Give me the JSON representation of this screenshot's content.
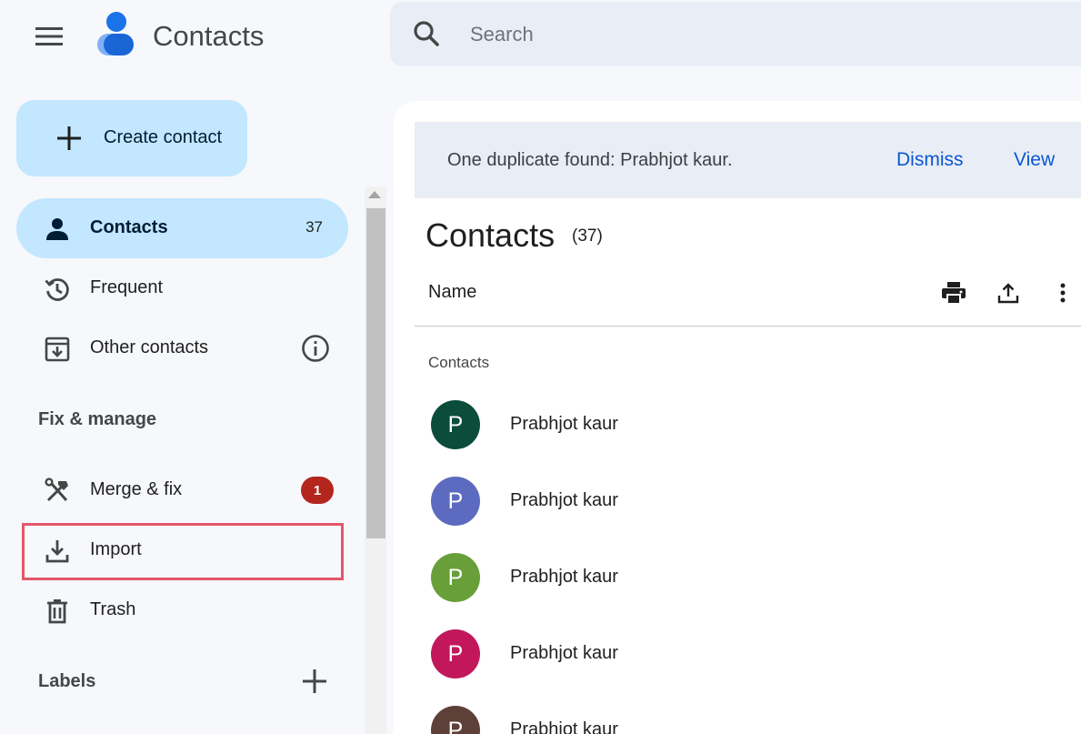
{
  "header": {
    "app_title": "Contacts",
    "search_placeholder": "Search",
    "menu_icon": "hamburger-menu-icon",
    "logo": "contacts-logo"
  },
  "sidebar": {
    "create_label": "Create contact",
    "nav": [
      {
        "label": "Contacts",
        "count": "37",
        "icon": "person-icon",
        "active": true
      },
      {
        "label": "Frequent",
        "icon": "history-icon"
      },
      {
        "label": "Other contacts",
        "icon": "archive-download-icon",
        "extra_icon": "info-icon"
      }
    ],
    "fix_heading": "Fix & manage",
    "fix_items": [
      {
        "label": "Merge & fix",
        "icon": "merge-tools-icon",
        "badge": "1"
      },
      {
        "label": "Import",
        "icon": "download-icon",
        "highlighted": true
      },
      {
        "label": "Trash",
        "icon": "trash-icon"
      }
    ],
    "labels_heading": "Labels"
  },
  "banner": {
    "message": "One duplicate found: Prabhjot kaur.",
    "dismiss_label": "Dismiss",
    "view_label": "View"
  },
  "main": {
    "title": "Contacts",
    "count": "(37)",
    "column_name": "Name",
    "group_label": "Contacts",
    "contacts": [
      {
        "name": "Prabhjot kaur",
        "initial": "P",
        "color": "#0b4c3a"
      },
      {
        "name": "Prabhjot kaur",
        "initial": "P",
        "color": "#5c6bc0"
      },
      {
        "name": "Prabhjot kaur",
        "initial": "P",
        "color": "#689f38"
      },
      {
        "name": "Prabhjot kaur",
        "initial": "P",
        "color": "#c2185b"
      },
      {
        "name": "Prabhjot kaur",
        "initial": "P",
        "color": "#5d4037"
      }
    ]
  },
  "colors": {
    "accent": "#0b57d0",
    "active_bg": "#c2e7ff",
    "badge": "#b3261e",
    "highlight": "#e5566a"
  }
}
